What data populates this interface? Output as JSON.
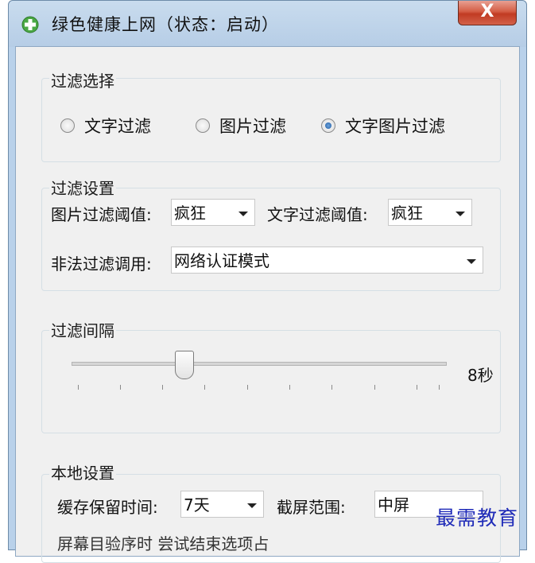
{
  "window": {
    "title": "绿色健康上网（状态：启动）",
    "close_label": "X"
  },
  "filter_select": {
    "label": "过滤选择",
    "options": [
      "文字过滤",
      "图片过滤",
      "文字图片过滤"
    ],
    "selected": "文字图片过滤"
  },
  "filter_settings": {
    "label": "过滤设置",
    "image_threshold_label": "图片过滤阈值:",
    "image_threshold_value": "疯狂",
    "text_threshold_label": "文字过滤阈值:",
    "text_threshold_value": "疯狂",
    "illegal_call_label": "非法过滤调用:",
    "illegal_call_value": "网络认证模式"
  },
  "filter_interval": {
    "label": "过滤间隔",
    "value_label": "8秒"
  },
  "local_settings": {
    "label": "本地设置",
    "cache_label": "缓存保留时间:",
    "cache_value": "7天",
    "screenshot_label": "截屏范围:",
    "screenshot_value": "中屏",
    "partial_row_text": "屏幕目验序时  尝试结束选项占"
  },
  "watermark": "最需教育"
}
